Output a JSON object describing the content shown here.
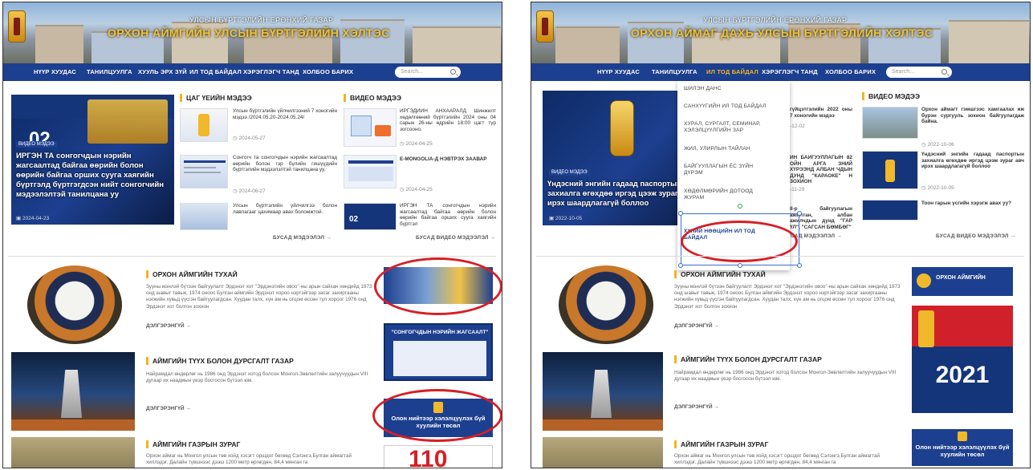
{
  "left": {
    "banner": {
      "top": "УЛСЫН БҮРТГЭЛИЙН ЕРӨНХИЙ ГАЗАР",
      "title": "ОРХОН АЙМГИЙН УЛСЫН БҮРТГЭЛИЙН ХЭЛТЭС"
    },
    "nav": [
      "НҮҮР ХУУДАС",
      "ТАНИЛЦУУЛГА",
      "ХУУЛЬ ЭРХ ЗҮЙ",
      "ИЛ ТОД БАЙДАЛ",
      "ХЭРЭГЛЭГЧ ТАНД",
      "ХОЛБОО БАРИХ"
    ],
    "search_placeholder": "Search...",
    "hero": {
      "tag": "ВИДЕО МЭДЭЭ",
      "caption": "ИРГЭН ТА сонгогчдын нэрийн жагсаалтад байгаа өөрийн болон өөрийн байгаа орших сууга хаягийн бүртгэлд бүртгэгдсэн нийт сонгогчийн мэдээлэлтэй танилцана уу",
      "date": "2024-04-23"
    },
    "news_heading": "ЦАГ ҮЕИЙН МЭДЭЭ",
    "news": [
      {
        "text": "Улсын бүртгэлийн үйлчилгээний 7 хоногийн мэдээ /2024.05.20-2024.05.24/",
        "date": "2024-05-27"
      },
      {
        "text": "Сонгогч та сонгогчдын нэрийн жагсаалтад өөрийн болон гэр бүлийн гишүүдийн бүртгэлийн мэдээлэлтэй танилцана уу.",
        "date": "2024-06-27"
      },
      {
        "text": "Улсын бүртгэлийн үйлчилгээ болон лавлагааг цахимаар авах боломжтой.",
        "date": ""
      }
    ],
    "video_heading": "ВИДЕО МЭДЭЭ",
    "videos": [
      {
        "text": "ИРГЭДИЙН АНХААРАЛД Шинжилт хөдөлгөөний бүртгэлийн 2024 оны 04 сарын 26-ны өдрийн 18:00 цагт түр зогсооно.",
        "date": "2024-04-25"
      },
      {
        "text": "E-MONGOLIA-Д НЭВТРЭХ ЗААВАР",
        "date": "2024-04-25"
      },
      {
        "text": "ИРГЭН ТА сонгогчдын нэрийн жагсаалтад байгаа өөрийн болон өөрийн байгаа орших сууга хаягийн бүртгэл",
        "date": ""
      }
    ],
    "more_news": "БУСАД МЭДЭЭЛЭЛ →",
    "more_videos": "БУСАД ВИДЕО МЭДЭЭЛЭЛ →",
    "sections": [
      {
        "title": "ОРХОН АЙМГИЙН ТУХАЙ",
        "text": "Зууны мэнлэй бүтээн байгуулалт Эрдэнэт хот \"Эрдэнэтийн овоо\"-ны арын сайхан хөндийд 1973 онд шавыг тавьж, 1974 онoос Булган аймгийн Эрдэнэт хороо нэртэйгээр засаг захиргааны нэгжийн хувьд үүсгэн байгуулагдсан. Хуудан талх, хүн ам нь огцом өссөн тул хороог 1976 онд Эрдэнэт хот болгон зохион",
        "more": "ДЭЛГЭРЭНГҮЙ →"
      },
      {
        "title": "АЙМГИЙН ТҮҮХ БОЛОН ДУРСГАЛТ ГАЗАР",
        "text": "Найрамдал өндөрлөг нь 1986 онд Эрдэнэт хотод болсон Монгол-Зөвлөлтийн залуучуудын VIII дугаар их наадмын үеэр босгосон бүтээл юм.",
        "more": "ДЭЛГЭРЭНГҮЙ →"
      },
      {
        "title": "АЙМГИЙН ГАЗРЫН ЗУРАГ",
        "text": "Орхон аймаг нь Монгол улсын төв хойд хэсэгт оршдог бөгөөд Сэлэнгэ,Булган аймагтай хиллэдэг. Далайн түвшнээс дээш 1200 метр өргөгдөн, 84,4 мянган га",
        "more": ""
      }
    ],
    "ad1": "\"СОНГОГЧДЫН НЭРИЙН ЖАГСААЛТ\"",
    "ad2": "Олон нийтээр хэлэлцүүлэх бүй хуулийн төсөл",
    "ad3": "110"
  },
  "right": {
    "banner": {
      "top": "УЛСЫН БҮРТГЭЛИЙН ЕРӨНХИЙ ГАЗАР",
      "title": "ОРХОН АЙМАГ ДАХЬ УЛСЫН БҮРТГЭЛИЙН ХЭЛТЭС"
    },
    "nav": [
      "НҮҮР ХУУДАС",
      "ТАНИЛЦУУЛГА",
      "ИЛ ТОД БАЙДАЛ",
      "ХЭРЭГЛЭГЧ ТАНД",
      "ХОЛБОО БАРИХ"
    ],
    "search_placeholder": "Search...",
    "dropdown": [
      "ШИЛЭН ДАНС",
      "САНХҮҮГИЙН ИЛ ТОД БАЙДАЛ",
      "ХУРАЛ, СУРГАЛТ, СЕМИНАР, ХЭЛЭЛЦҮҮЛГИЙН ЗАР",
      "ЖИЛ, УЛИРЛЫН ТАЙЛАН",
      "БАЙГУУЛЛАГЫН ЁС ЗҮЙН ДҮРЭМ",
      "ХӨДӨЛМӨРИЙН ДОТООД ЖУРАМ",
      "ХҮНИЙ НӨӨЦИЙН ИЛ ТОД БАЙДАЛ"
    ],
    "hero": {
      "tag": "ВИДЕО МЭДЭЭ",
      "caption": "Үндэсний энгийн гадаад паспортын захиалга өгөхдөө иргэд цээж зураг авч ирэх шаардлагагүй боллоо",
      "date": "2022-10-05"
    },
    "behind_news": [
      "гүйцэтгэлийн 2022 оны 7 хоногийн мэдээ",
      "-12-02",
      "ЙН БАЙГУУЛЛАГЫН 82 ОЙН АРГА ЗНИЙ ХҮРЭЭНД АЛБАН ЧДЫН ДУНД \"КАРАОКЕ\" Н ЗОХИОН",
      "-11-29",
      "II-р байгуулагын ажилтан, албан ажилчдын дунд \"ГАР ҮЛ\", \"САГСАН БӨМБӨГ\""
    ],
    "more_news": "БУСАД МЭДЭЭЛЭЛ →",
    "video_heading": "ВИДЕО МЭДЭЭ",
    "videos": [
      {
        "text": "Орхон аймагт гэмшгээс хамгаалах иж бүрэн сургууль зохион байгуулагдаж байна.",
        "date": "2022-10-06"
      },
      {
        "text": "Үндэсний энгийн гадаад паспортын захиалга өгөхдөө иргэд цээж зураг авч ирэх шаардлагагүй боллоо",
        "date": "2022-10-05"
      },
      {
        "text": "Тоон гарын үсгийн хэрэгж авах уу?",
        "date": ""
      }
    ],
    "more_videos": "БУСАД ВИДЕО МЭДЭЭЛЭЛ →",
    "sections": [
      {
        "title": "ОРХОН АЙМГИЙН ТУХАЙ",
        "text": "Зууны мэнлэй бүтээн байгуулалт Эрдэнэт хот \"Эрдэнэтийн овоо\"-ны арын сайхан хөндийд 1973 онд шавыг тавьж, 1974 онoос Булган аймгийн Эрдэнэт хороо нэртэйгээр засаг захиргааны нэгжийн хувьд үүсгэн байгуулагдсан. Хуудан талх, хүн ам нь огцом өссөн тул хороог 1976 онд Эрдэнэт хот болгон зохион",
        "more": "ДЭЛГЭРЭНГҮЙ →"
      },
      {
        "title": "АЙМГИЙН ТҮҮХ БОЛОН ДУРСГАЛТ ГАЗАР",
        "text": "Найрамдал өндөрлөг нь 1986 онд Эрдэнэт хотод болсон Монгол-Зөвлөлтийн залуучуудын VIII дугаар их наадмын үеэр босгосон бүтээл юм.",
        "more": "ДЭЛГЭРЭНГҮЙ →"
      },
      {
        "title": "АЙМГИЙН ГАЗРЫН ЗУРАГ",
        "text": "Орхон аймаг нь Монгол улсын төв хойд хэсэгт оршдог бөгөөд Сэлэнгэ,Булган аймагтай хиллэдэг. Далайн түвшнээс дээш 1200 метр өргөгдөн, 84,4 мянган га",
        "more": ""
      }
    ],
    "ad_logo": "ОРХОН АЙМГИЙН",
    "ad_year": "2021",
    "ad2": "Олон нийтээр хэлэлцүүлэх бүй хуулийн төсөл"
  },
  "colors": {
    "nav": "#1d3f8f",
    "accent": "#f2b51e",
    "annotation": "#d61f26"
  }
}
